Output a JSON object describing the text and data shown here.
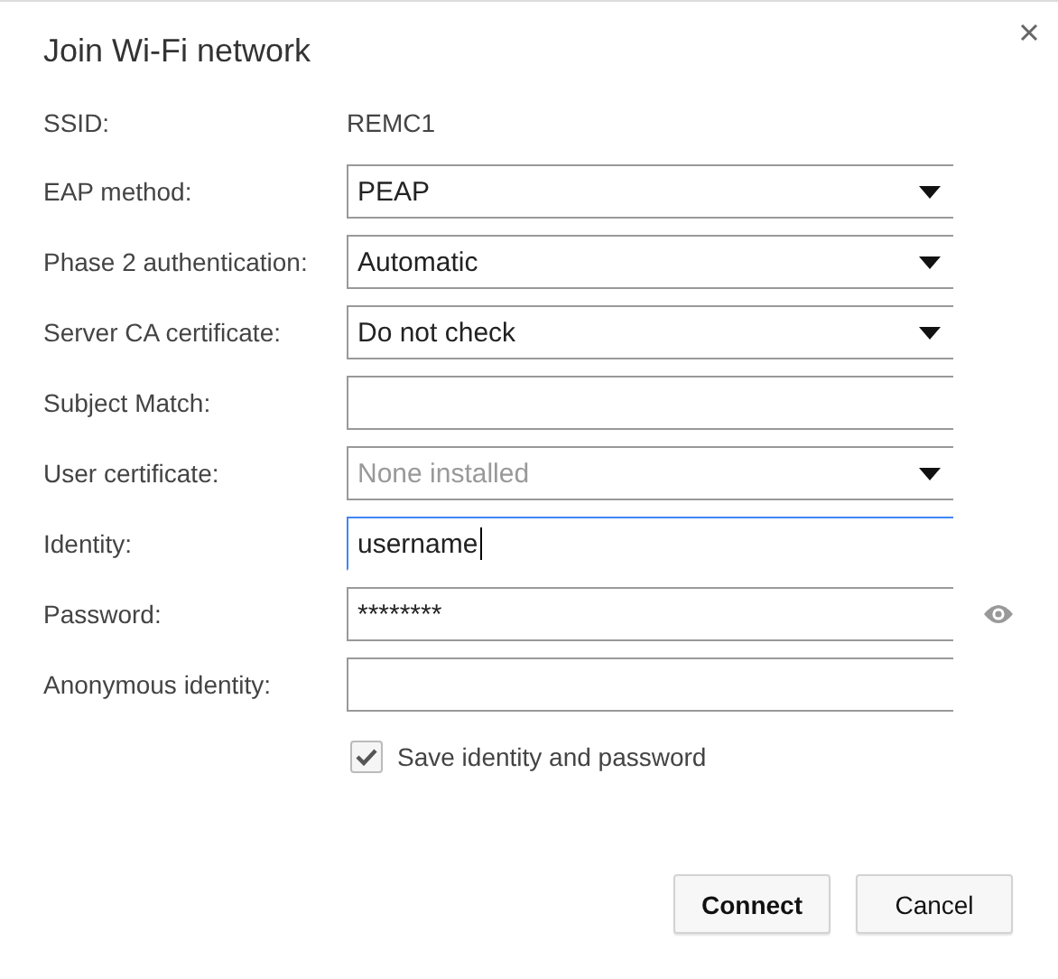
{
  "dialog": {
    "title": "Join Wi-Fi network"
  },
  "rows": [
    {
      "kind": "text",
      "label": "SSID:",
      "value": "REMC1"
    },
    {
      "kind": "select",
      "label": "EAP method:",
      "value": "PEAP",
      "disabled": false
    },
    {
      "kind": "select",
      "label": "Phase 2 authentication:",
      "value": "Automatic",
      "disabled": false
    },
    {
      "kind": "select",
      "label": "Server CA certificate:",
      "value": "Do not check",
      "disabled": false
    },
    {
      "kind": "input",
      "label": "Subject Match:",
      "focused": false
    },
    {
      "kind": "select",
      "label": "User certificate:",
      "value": "None installed",
      "disabled": true
    },
    {
      "kind": "input",
      "label": "Identity:",
      "value": "username",
      "focused": true
    },
    {
      "kind": "password",
      "label": "Password:",
      "value": "********",
      "focused": false
    },
    {
      "kind": "input",
      "label": "Anonymous identity:",
      "focused": false
    }
  ],
  "save_checkbox": {
    "label": "Save identity and password",
    "checked": true
  },
  "buttons": [
    {
      "label": "Connect",
      "kind": "primary"
    },
    {
      "label": "Cancel",
      "kind": "normal"
    }
  ]
}
